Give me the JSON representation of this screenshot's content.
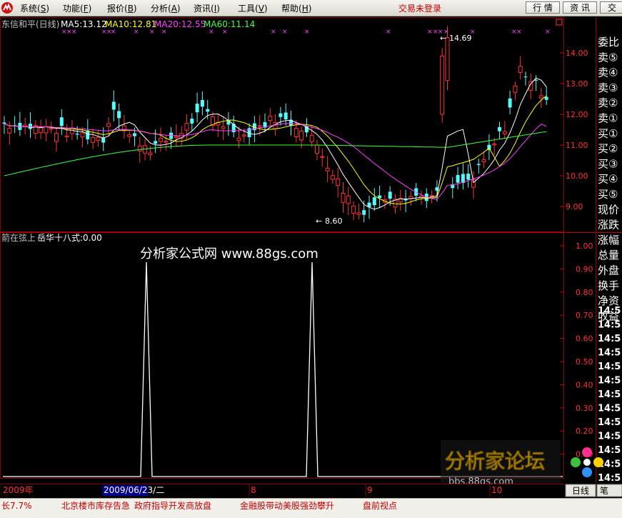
{
  "menubar": {
    "items": [
      {
        "label": "系统",
        "acc": "S"
      },
      {
        "label": "功能",
        "acc": "F"
      },
      {
        "label": "报价",
        "acc": "B"
      },
      {
        "label": "分析",
        "acc": "A"
      },
      {
        "label": "资讯",
        "acc": "I"
      },
      {
        "label": "工具",
        "acc": "V"
      },
      {
        "label": "帮助",
        "acc": "H"
      }
    ],
    "login_status": "交易未登录",
    "buttons": [
      "行 情",
      "资 讯",
      "交"
    ]
  },
  "main_chart": {
    "stock_label": "东信和平(日线)",
    "ma": [
      {
        "text": "MA5:13.12",
        "color": "#ffffff"
      },
      {
        "text": "MA10:12.81",
        "color": "#ffff00"
      },
      {
        "text": "MA20:12.55",
        "color": "#ff40ff"
      },
      {
        "text": "MA60:11.14",
        "color": "#40ff40"
      }
    ],
    "y_ticks": [
      "14.00",
      "13.00",
      "12.00",
      "11.00",
      "10.00",
      "9.00"
    ],
    "high_label": "14.69",
    "low_label": "8.60",
    "colors": {
      "up": "#ff3232",
      "down": "#54fcfc",
      "grid": "#8b0000",
      "axis_text": "#ff3232"
    }
  },
  "indicator": {
    "title_left": "箭在弦上",
    "title_right": "岳华十八式:0.00",
    "y_ticks": [
      "1.00",
      "0.90",
      "0.80",
      "0.70",
      "0.60",
      "0.50",
      "0.40",
      "0.30",
      "0.20",
      "0.10"
    ],
    "watermark": "分析家公式网 www.88gs.com"
  },
  "right_panel": {
    "labels": [
      "委比",
      "卖⑤",
      "卖④",
      "卖③",
      "卖②",
      "卖①",
      "买①",
      "买②",
      "买③",
      "买④",
      "买⑤",
      "现价",
      "涨跌",
      "涨幅",
      "总量",
      "外盘",
      "换手",
      "净资",
      "收益"
    ],
    "times": [
      "14:5",
      "14:5",
      "14:5",
      "14:5",
      "14:5",
      "14:5",
      "14:5",
      "14:5",
      "14:5",
      "14:5",
      "14:5",
      "14:5",
      "14:5",
      "14:5",
      "14:5"
    ]
  },
  "time_axis": {
    "year": "2009年",
    "cursor_date": "2009/06/23/二",
    "months": [
      "8",
      "9",
      "10"
    ],
    "period_btn": "日线",
    "pen_btn": "笔"
  },
  "forum_logo": {
    "title": "分析家论坛",
    "url": "bbs.88gs.com"
  },
  "ticker": {
    "items": [
      "长7.7%",
      "北京楼市库存告急",
      "政府指导开发商放盘",
      "金融股带动美股强劲攀升",
      "盘前视点"
    ]
  }
}
